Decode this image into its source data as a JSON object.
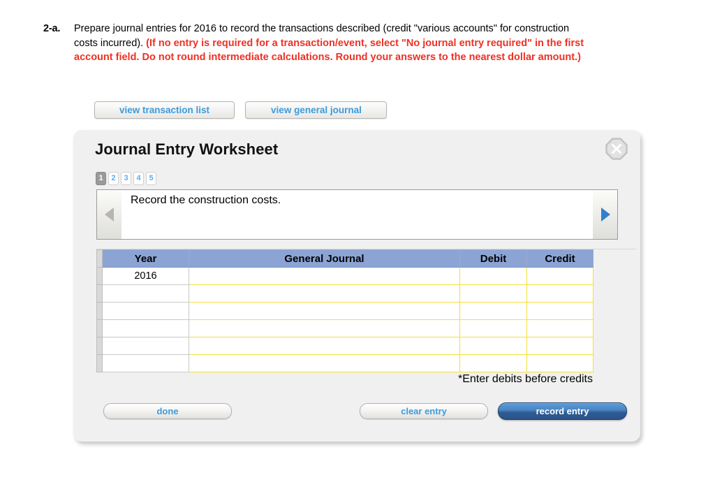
{
  "question": {
    "number": "2-a.",
    "black_text": "Prepare journal entries for 2016 to record the transactions described (credit \"various accounts\" for construction costs incurred). ",
    "red_text": "(If no entry is required for a transaction/event, select \"No journal entry required\" in the first account field. Do not round intermediate calculations. Round your answers to the nearest dollar amount.)",
    "red_color": "#ee3124"
  },
  "top_buttons": {
    "view_transaction_list": "view transaction list",
    "view_general_journal": "view general journal",
    "link_color": "#3c9bdb"
  },
  "panel": {
    "title": "Journal Entry Worksheet",
    "close_icon": "close-x-icon",
    "background": "#f0f0f0"
  },
  "pagination": {
    "pages": [
      "1",
      "2",
      "3",
      "4",
      "5"
    ],
    "active_index": 0,
    "active_bg": "#9a9a9a",
    "inactive_color": "#5cacee"
  },
  "navigation": {
    "prev_icon": "triangle-left-icon",
    "next_icon": "triangle-right-icon",
    "prev_enabled": false,
    "next_enabled": true,
    "prev_color": "#b5b5b5",
    "next_color": "#2f7fd0",
    "instruction": "Record the construction costs."
  },
  "table": {
    "header_bg": "#8ca4d4",
    "input_border": "#f2e03a",
    "columns": [
      "Year",
      "General Journal",
      "Debit",
      "Credit"
    ],
    "rows": [
      {
        "year": "2016",
        "general_journal": "",
        "debit": "",
        "credit": ""
      },
      {
        "year": "",
        "general_journal": "",
        "debit": "",
        "credit": ""
      },
      {
        "year": "",
        "general_journal": "",
        "debit": "",
        "credit": ""
      },
      {
        "year": "",
        "general_journal": "",
        "debit": "",
        "credit": ""
      },
      {
        "year": "",
        "general_journal": "",
        "debit": "",
        "credit": ""
      },
      {
        "year": "",
        "general_journal": "",
        "debit": "",
        "credit": ""
      }
    ],
    "footnote": "*Enter debits before credits"
  },
  "actions": {
    "done": "done",
    "clear_entry": "clear entry",
    "record_entry": "record entry",
    "record_entry_bg": "#3f79b8"
  }
}
